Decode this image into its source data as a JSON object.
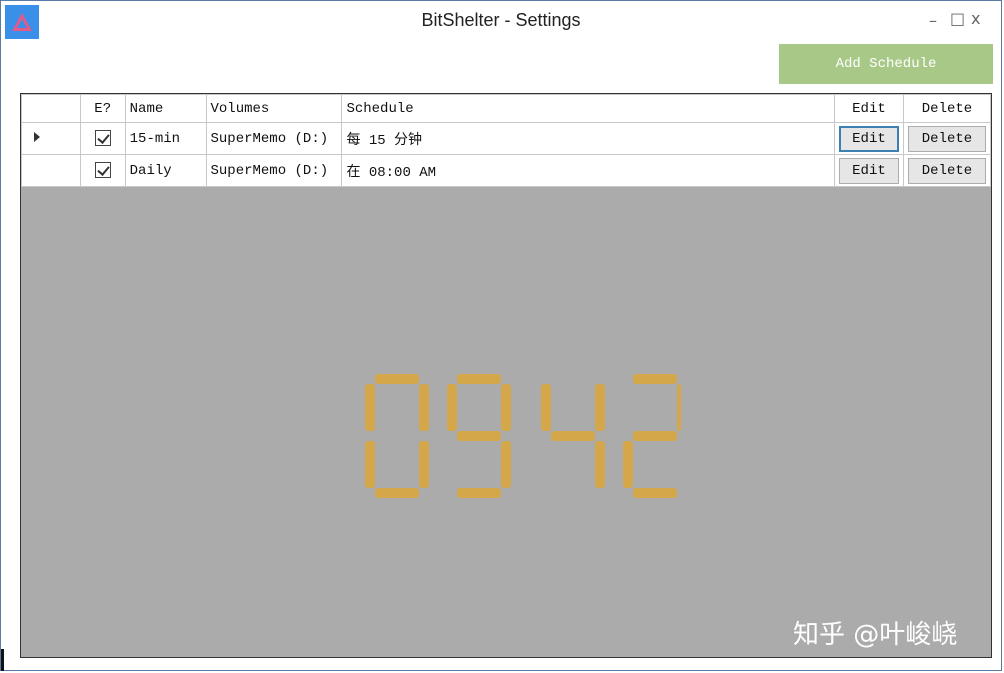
{
  "window": {
    "title": "BitShelter - Settings",
    "minimize": "–",
    "maximize": "□",
    "close": "x"
  },
  "toolbar": {
    "add_schedule_label": "Add Schedule"
  },
  "table": {
    "columns": [
      "E?",
      "Name",
      "Volumes",
      "Schedule",
      "Edit",
      "Delete"
    ],
    "rows": [
      {
        "enabled": true,
        "name": "15-min",
        "volumes": "SuperMemo (D:)",
        "schedule": "每 15 分钟",
        "edit_label": "Edit",
        "delete_label": "Delete",
        "current": true
      },
      {
        "enabled": true,
        "name": "Daily",
        "volumes": "SuperMemo (D:)",
        "schedule": "在 08:00 AM",
        "edit_label": "Edit",
        "delete_label": "Delete",
        "current": false
      }
    ]
  },
  "clock": {
    "display": "09 42",
    "color": "#d4a84a"
  },
  "watermark": "知乎 @叶峻峣",
  "colors": {
    "accent_button": "#a8c888",
    "grid_background": "#ababab",
    "app_icon": "#3a8fe8"
  }
}
